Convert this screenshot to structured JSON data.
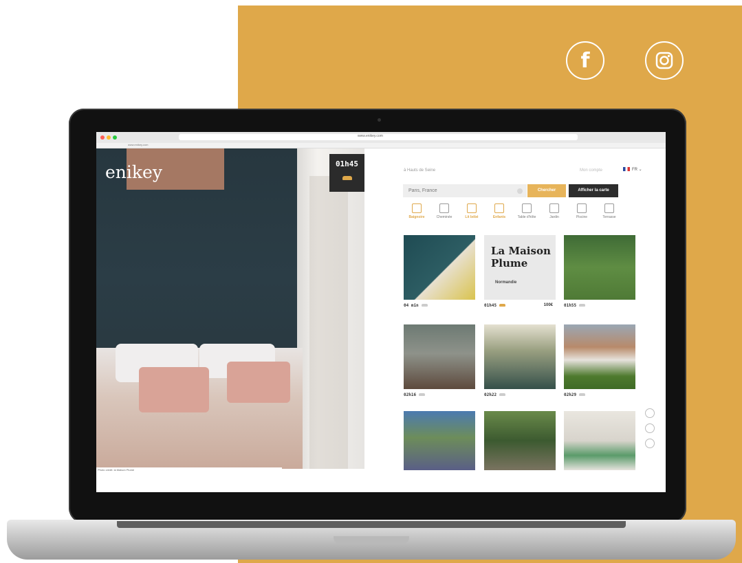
{
  "social": {
    "facebook_icon": "facebook-icon",
    "instagram_icon": "instagram-icon"
  },
  "colors": {
    "accent": "#dfa84a",
    "dark": "#2d2d2d"
  },
  "browser": {
    "url": "www.enikey.com"
  },
  "site": {
    "logo": "enikey",
    "hero_time": "01h45",
    "hero_caption": "Photo credit: la Maison Plume",
    "top_note": "à Hauts de Seine",
    "account": "Mon compte",
    "lang": "FR"
  },
  "search": {
    "placeholder": "Paris, France",
    "search_label": "Chercher",
    "map_label": "Afficher la carte"
  },
  "filters": [
    {
      "label": "Baignoire",
      "active": true
    },
    {
      "label": "Cheminée",
      "active": false
    },
    {
      "label": "Lit bébé",
      "active": true
    },
    {
      "label": "Enfants",
      "active": true
    },
    {
      "label": "Table d'hôte",
      "active": false
    },
    {
      "label": "Jardin",
      "active": false
    },
    {
      "label": "Piscine",
      "active": false
    },
    {
      "label": "Terrasse",
      "active": false
    }
  ],
  "listings": [
    {
      "time": "04 min",
      "price": ""
    },
    {
      "time": "01h45",
      "price": "100€",
      "title": "La Maison Plume",
      "region": "Normandie"
    },
    {
      "time": "01h55",
      "price": ""
    },
    {
      "time": "02h16",
      "price": ""
    },
    {
      "time": "02h22",
      "price": ""
    },
    {
      "time": "02h29",
      "price": ""
    },
    {
      "time": "",
      "price": ""
    },
    {
      "time": "",
      "price": ""
    },
    {
      "time": "",
      "price": ""
    }
  ]
}
